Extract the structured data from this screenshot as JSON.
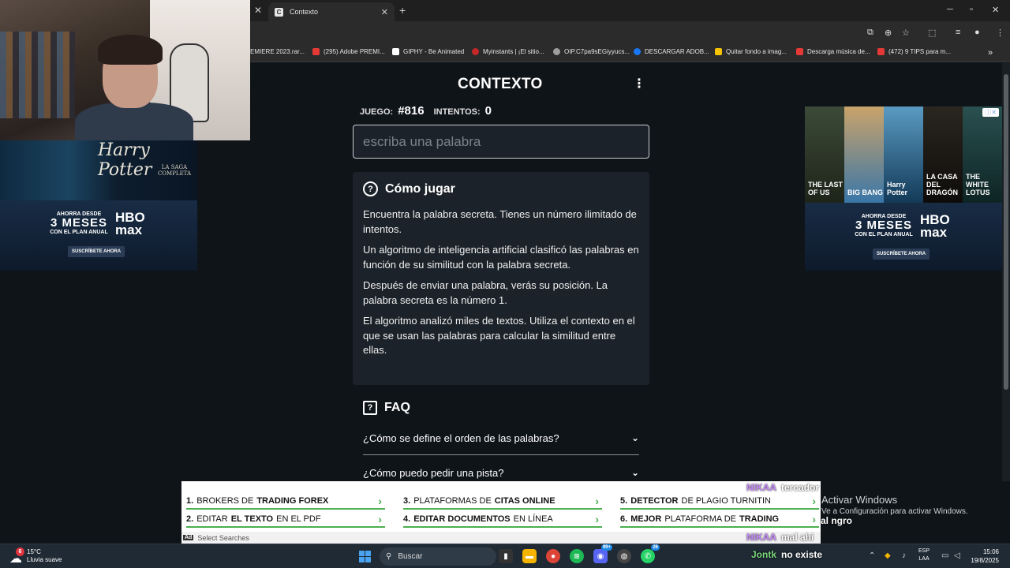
{
  "browser": {
    "tab_title": "Contexto",
    "tab_favicon": "C",
    "bookmarks": [
      {
        "label": "EMIERE 2023.rar...",
        "color": "#2b2b2b"
      },
      {
        "label": "(295) Adobe PREMI...",
        "color": "#e53935"
      },
      {
        "label": "GIPHY - Be Animated",
        "color": "#ffffff"
      },
      {
        "label": "Myinstants | ¡El sitio...",
        "color": "#c62828"
      },
      {
        "label": "OIP.C7pa9sEGiyyucs...",
        "color": "#9e9e9e"
      },
      {
        "label": "DESCARGAR ADOB...",
        "color": "#1877f2"
      },
      {
        "label": "Quitar fondo a imag...",
        "color": "#f6c300"
      },
      {
        "label": "Descarga música de...",
        "color": "#e53935"
      },
      {
        "label": "(472) 9 TIPS para m...",
        "color": "#e53935"
      }
    ],
    "overflow": "»"
  },
  "game": {
    "title": "CONTEXTO",
    "menu_icon": "⋮",
    "game_label": "JUEGO:",
    "game_number": "#816",
    "attempts_label": "INTENTOS:",
    "attempts_value": "0",
    "input_placeholder": "escriba una palabra",
    "input_value": ""
  },
  "how_to": {
    "title": "Cómo jugar",
    "paragraphs": [
      "Encuentra la palabra secreta. Tienes un número ilimitado de intentos.",
      "Un algoritmo de inteligencia artificial clasificó las palabras en función de su similitud con la palabra secreta.",
      "Después de enviar una palabra, verás su posición. La palabra secreta es la número 1.",
      "El algoritmo analizó miles de textos. Utiliza el contexto en el que se usan las palabras para calcular la similitud entre ellas."
    ]
  },
  "faq": {
    "title": "FAQ",
    "items": [
      "¿Cómo se define el orden de las palabras?",
      "¿Cómo puedo pedir una pista?"
    ]
  },
  "ads": {
    "left_logo": "Harry Potter",
    "left_sub": "LA SAGA COMPLETA",
    "promo_small": "AHORRA DESDE",
    "promo_big": "3 MESES",
    "promo_plan": "CON EL PLAN ANUAL",
    "brand_top": "HBO",
    "brand_bottom": "max",
    "cta": "SUSCRÍBETE AHORA",
    "right_posters": [
      {
        "label": "THE LAST OF US",
        "color": "#2f3a2a"
      },
      {
        "label": "BIG BANG",
        "color": "#3a76a8"
      },
      {
        "label": "Harry Potter",
        "color": "#1e4e73"
      },
      {
        "label": "LA CASA DEL DRAGÓN",
        "color": "#2a2620"
      },
      {
        "label": "THE WHITE LOTUS",
        "color": "#1c3a3a"
      }
    ],
    "adchoice": "ⓘ✕"
  },
  "bottom_ad": {
    "items": [
      {
        "num": "1.",
        "pre": "BROKERS DE",
        "strong": "TRADING FOREX",
        "post": ""
      },
      {
        "num": "2.",
        "pre": "EDITAR",
        "strong": "EL TEXTO",
        "post": "EN EL PDF"
      },
      {
        "num": "3.",
        "pre": "PLATAFORMAS DE",
        "strong": "CITAS ONLINE",
        "post": ""
      },
      {
        "num": "4.",
        "pre": "EDITAR DOCUMENTOS",
        "strong": "",
        "post": "EN LÍNEA"
      },
      {
        "num": "5.",
        "pre": "DETECTOR",
        "strong": "DE PLAGIO TURNITIN",
        "post": ""
      },
      {
        "num": "6.",
        "pre": "MEJOR",
        "strong": "PLATAFORMA DE",
        "post": "TRADING"
      }
    ],
    "tag": "Ad",
    "footer_label": "Select Searches"
  },
  "overlay": {
    "chat": [
      {
        "user": "NIKAA",
        "msg": "tercador"
      },
      {
        "user": "NIKAA",
        "msg": "Activar Windows"
      },
      {
        "user": "NIKAA",
        "msg": "mal ahi"
      },
      {
        "user": "Jontk",
        "msg": "no existe"
      }
    ],
    "activate_title": "Activar Windows",
    "activate_sub": "Ve a Configuración para activar Windows.",
    "extra_chat": "al ngro"
  },
  "taskbar": {
    "weather_temp": "15°C",
    "weather_desc": "Lluvia suave",
    "weather_badge": "6",
    "search_placeholder": "Buscar",
    "lang_1": "ESP",
    "lang_2": "LAA",
    "time": "15:06",
    "date": "19/8/2025",
    "badges": {
      "discord": "99+",
      "whatsapp": "26"
    }
  }
}
